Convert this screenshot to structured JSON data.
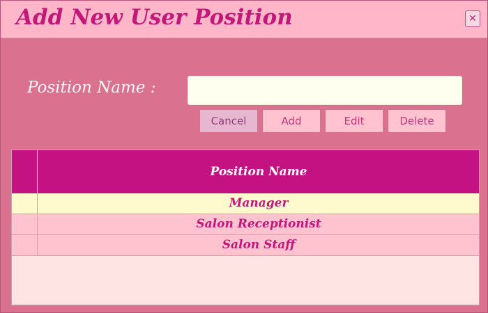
{
  "window": {
    "title": "Add New User Position",
    "close_glyph": "✕",
    "close_icon": "close-icon"
  },
  "form": {
    "position_label": "Position Name :",
    "position_value": "",
    "position_placeholder": ""
  },
  "buttons": {
    "cancel": "Cancel",
    "add": "Add",
    "edit": "Edit",
    "delete": "Delete"
  },
  "table": {
    "header": "Position Name",
    "rows": [
      {
        "name": "Manager",
        "selected": true
      },
      {
        "name": "Salon Receptionist",
        "selected": false
      },
      {
        "name": "Salon Staff",
        "selected": false
      }
    ]
  },
  "colors": {
    "accent": "#c41282",
    "window_bg": "#d9718f",
    "titlebar_bg": "#ffb6c8",
    "row_bg": "#ffc2cf",
    "selected_row_bg": "#fffacd"
  }
}
